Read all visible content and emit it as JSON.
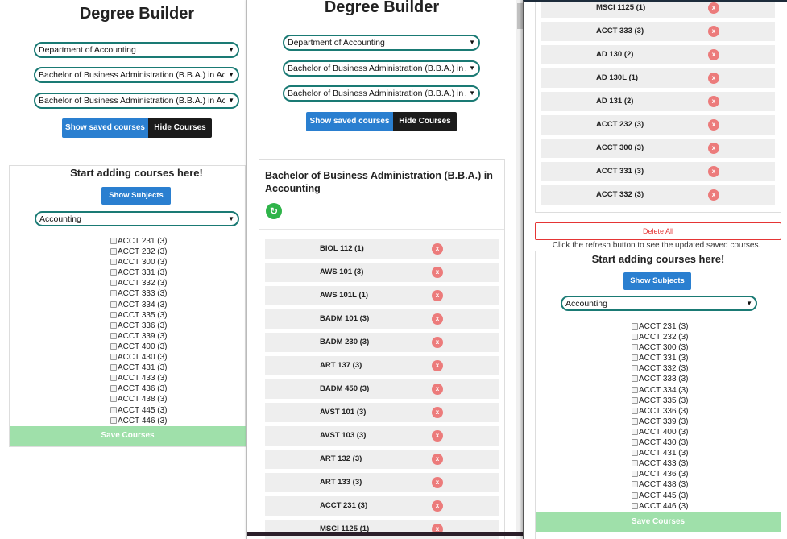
{
  "panel1": {
    "title": "Degree Builder",
    "department_select": "Department of Accounting",
    "program_select_1": "Bachelor of Business Administration (B.B.A.) in Accounting",
    "program_select_2": "Bachelor of Business Administration (B.B.A.) in Accounting",
    "show_saved_label": "Show saved courses",
    "hide_courses_label": "Hide Courses",
    "adding_title": "Start adding courses here!",
    "show_subjects_label": "Show Subjects",
    "subject_select": "Accounting",
    "courses": [
      "ACCT 231 (3)",
      "ACCT 232 (3)",
      "ACCT 300 (3)",
      "ACCT 331 (3)",
      "ACCT 332 (3)",
      "ACCT 333 (3)",
      "ACCT 334 (3)",
      "ACCT 335 (3)",
      "ACCT 336 (3)",
      "ACCT 339 (3)",
      "ACCT 400 (3)",
      "ACCT 430 (3)",
      "ACCT 431 (3)",
      "ACCT 433 (3)",
      "ACCT 436 (3)",
      "ACCT 438 (3)",
      "ACCT 445 (3)",
      "ACCT 446 (3)"
    ],
    "save_label": "Save Courses"
  },
  "panel2": {
    "title": "Degree Builder",
    "department_select": "Department of Accounting",
    "program_select_1": "Bachelor of Business Administration (B.B.A.) in Accounting",
    "program_select_2": "Bachelor of Business Administration (B.B.A.) in Accounting",
    "show_saved_label": "Show saved courses",
    "hide_courses_label": "Hide Courses",
    "card_title": "Bachelor of Business Administration (B.B.A.) in Accounting",
    "refresh_icon": "refresh-icon",
    "delete_glyph": "x",
    "saved_courses": [
      "BIOL 112 (1)",
      "AWS 101 (3)",
      "AWS 101L (1)",
      "BADM 101 (3)",
      "BADM 230 (3)",
      "ART 137 (3)",
      "BADM 450 (3)",
      "AVST 101 (3)",
      "AVST 103 (3)",
      "ART 132 (3)",
      "ART 133 (3)",
      "ACCT 231 (3)",
      "MSCI 1125 (1)"
    ]
  },
  "panel3": {
    "saved_courses": [
      "MSCI 1125 (1)",
      "ACCT 333 (3)",
      "AD 130 (2)",
      "AD 130L (1)",
      "AD 131 (2)",
      "ACCT 232 (3)",
      "ACCT 300 (3)",
      "ACCT 331 (3)",
      "ACCT 332 (3)"
    ],
    "delete_glyph": "x",
    "delete_all_label": "Delete All",
    "hint": "Click the refresh button to see the updated saved courses.",
    "adding_title": "Start adding courses here!",
    "show_subjects_label": "Show Subjects",
    "subject_select": "Accounting",
    "courses": [
      "ACCT 231 (3)",
      "ACCT 232 (3)",
      "ACCT 300 (3)",
      "ACCT 331 (3)",
      "ACCT 332 (3)",
      "ACCT 333 (3)",
      "ACCT 334 (3)",
      "ACCT 335 (3)",
      "ACCT 336 (3)",
      "ACCT 339 (3)",
      "ACCT 400 (3)",
      "ACCT 430 (3)",
      "ACCT 431 (3)",
      "ACCT 433 (3)",
      "ACCT 436 (3)",
      "ACCT 438 (3)",
      "ACCT 445 (3)",
      "ACCT 446 (3)"
    ],
    "save_label": "Save Courses"
  },
  "colors": {
    "primary_blue": "#2a7fd0",
    "dark_button": "#1b1b1b",
    "select_border": "#1a7a74",
    "delete_red": "#ec7b7b",
    "refresh_green": "#2fb44a",
    "save_disabled_green": "#9fe0aa"
  }
}
